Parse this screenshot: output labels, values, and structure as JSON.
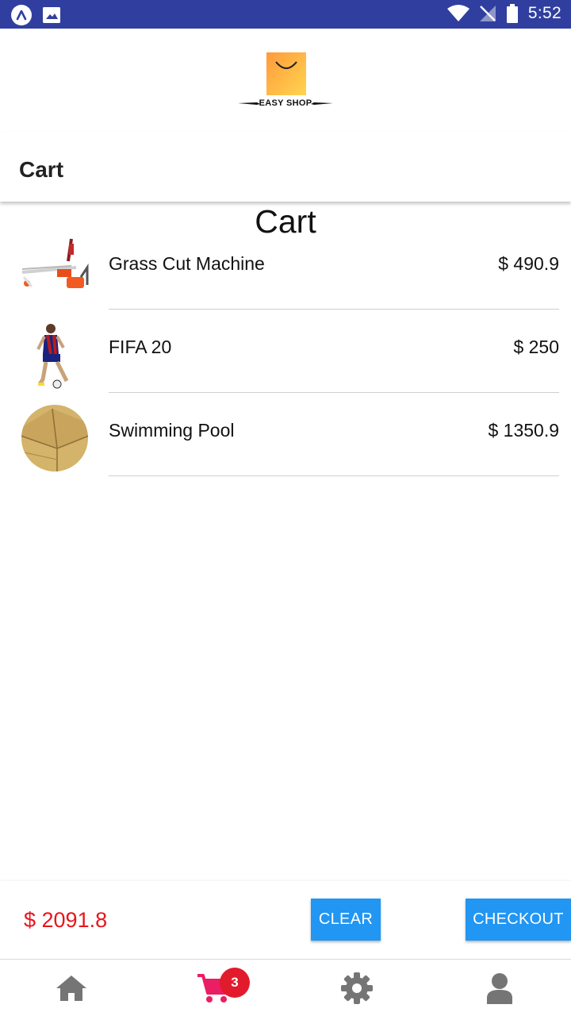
{
  "status_bar": {
    "time": "5:52"
  },
  "brand": {
    "logo_text": "EASY SHOP"
  },
  "appbar": {
    "title": "Cart"
  },
  "page": {
    "title": "Cart"
  },
  "cart": {
    "items": [
      {
        "name": "Grass Cut Machine",
        "price": "$ 490.9",
        "image": "grass-cutter-image"
      },
      {
        "name": "FIFA 20",
        "price": "$ 250",
        "image": "footballer-image"
      },
      {
        "name": "Swimming Pool",
        "price": "$ 1350.9",
        "image": "cardboard-box-image"
      }
    ],
    "total": "$ 2091.8",
    "clear_label": "CLEAR",
    "checkout_label": "CHECKOUT"
  },
  "bottom_nav": {
    "items": [
      {
        "icon": "home-icon"
      },
      {
        "icon": "cart-icon",
        "badge": "3"
      },
      {
        "icon": "settings-icon"
      },
      {
        "icon": "profile-icon"
      }
    ]
  },
  "colors": {
    "status_bar": "#303f9f",
    "accent_blue": "#2196f3",
    "total_red": "#e8151b",
    "cart_pink": "#e91e63",
    "nav_gray": "#757575"
  }
}
